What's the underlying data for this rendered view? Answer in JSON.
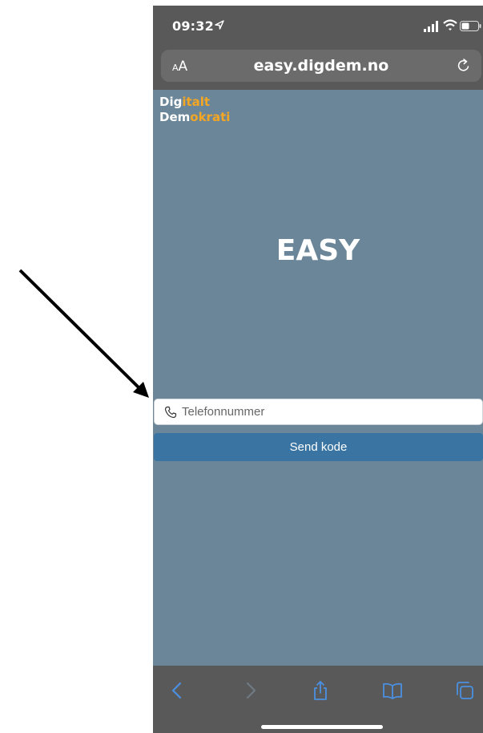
{
  "status_bar": {
    "time": "09:32"
  },
  "browser": {
    "url": "easy.digdem.no",
    "text_size_label_small": "A",
    "text_size_label_large": "A"
  },
  "logo": {
    "line1_white": "Dig",
    "line1_orange": "italt",
    "line2_white": "Dem",
    "line2_orange": "okrati"
  },
  "app": {
    "title": "EASY"
  },
  "form": {
    "phone_placeholder": "Telefonnummer",
    "phone_value": "",
    "send_button_label": "Send kode"
  },
  "colors": {
    "background": "#6a8698",
    "orange_accent": "#f5a623",
    "button_blue": "#3a74a2",
    "browser_chrome": "#595959",
    "toolbar_icon_blue": "#4a90e2",
    "arrow": "#000000"
  },
  "icons": [
    "location-arrow-icon",
    "cellular-signal-icon",
    "wifi-icon",
    "battery-icon",
    "reload-icon",
    "phone-icon",
    "back-icon",
    "forward-icon",
    "share-icon",
    "bookmarks-icon",
    "tabs-icon"
  ]
}
